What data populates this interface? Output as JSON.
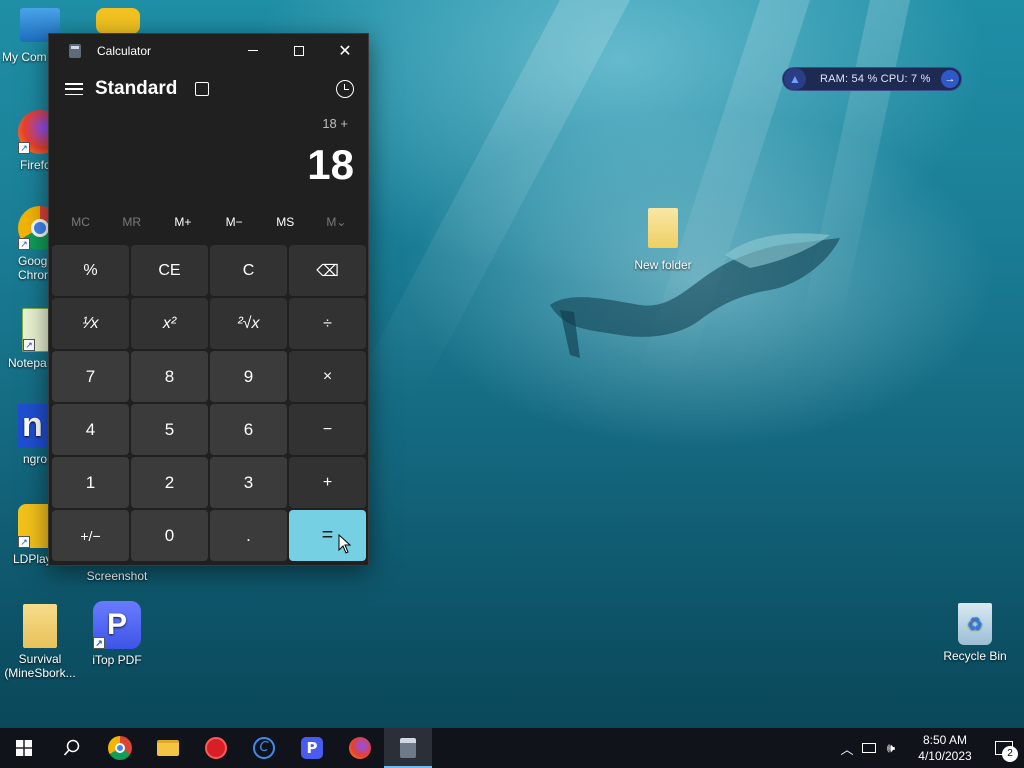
{
  "desktop": {
    "icons_left": [
      {
        "name": "my-computer",
        "label": "My Com"
      },
      {
        "name": "firefox",
        "label": "Firefo"
      },
      {
        "name": "chrome",
        "label": "Goog Chron"
      },
      {
        "name": "notepad",
        "label": "Notepa"
      },
      {
        "name": "ngrok",
        "label": "ngro"
      },
      {
        "name": "ldplayer",
        "label": "LDPlay"
      },
      {
        "name": "survival",
        "label": "Survival (MineSbork..."
      }
    ],
    "screenshot_label": "Screenshot",
    "itop_label": "iTop PDF",
    "new_folder_label": "New folder",
    "recycle_bin_label": "Recycle Bin"
  },
  "monitor": {
    "stats": "RAM: 54 %   CPU: 7 %"
  },
  "calculator": {
    "title": "Calculator",
    "mode": "Standard",
    "expression": "18 +",
    "display": "18",
    "memory": [
      "MC",
      "MR",
      "M+",
      "M−",
      "MS",
      "M⌄"
    ],
    "keys": [
      "%",
      "CE",
      "C",
      "⌫",
      "¹⁄x",
      "x²",
      "²√x",
      "÷",
      "7",
      "8",
      "9",
      "×",
      "4",
      "5",
      "6",
      "−",
      "1",
      "2",
      "3",
      "+",
      "+/−",
      "0",
      ".",
      "="
    ]
  },
  "taskbar": {
    "time": "8:50 AM",
    "date": "4/10/2023",
    "notification_count": "2"
  },
  "colors": {
    "accent_equals": "#76d0e3",
    "calc_bg": "#202020",
    "taskbar_bg": "#101319"
  }
}
